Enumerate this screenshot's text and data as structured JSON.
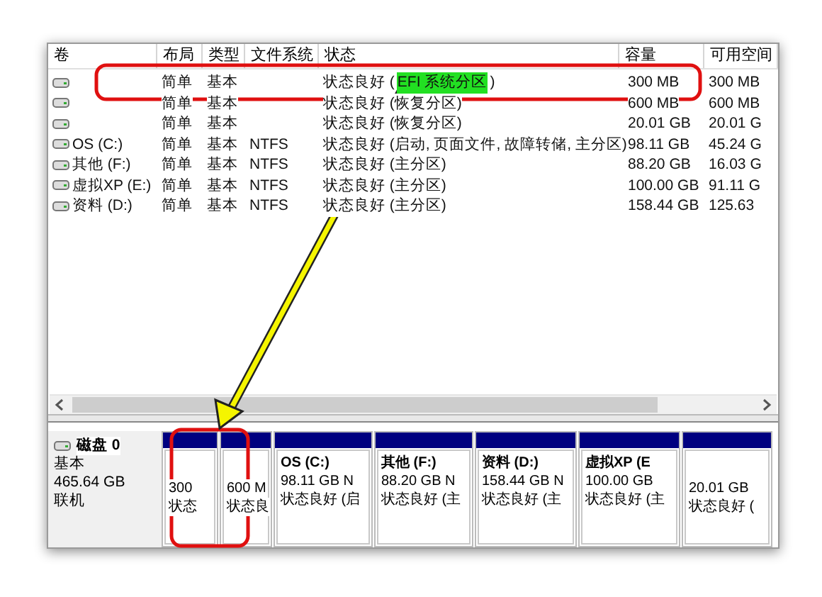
{
  "volume_table": {
    "columns": [
      "卷",
      "布局",
      "类型",
      "文件系统",
      "状态",
      "容量",
      "可用空间"
    ],
    "rows": [
      {
        "volume": "",
        "layout": "简单",
        "type": "基本",
        "file_system": "",
        "status": [
          {
            "text": "状态良好 (",
            "highlighted": false
          },
          {
            "text": "EFI 系统分区",
            "highlighted": true
          },
          {
            "text": ")",
            "highlighted": false
          }
        ],
        "capacity": "300 MB",
        "free_space": "300 MB"
      },
      {
        "volume": "",
        "layout": "简单",
        "type": "基本",
        "file_system": "",
        "status": [
          {
            "text": "状态良好 (恢复分区)",
            "highlighted": false
          }
        ],
        "capacity": "600 MB",
        "free_space": "600 MB"
      },
      {
        "volume": "",
        "layout": "简单",
        "type": "基本",
        "file_system": "",
        "status": [
          {
            "text": "状态良好 (恢复分区)",
            "highlighted": false
          }
        ],
        "capacity": "20.01 GB",
        "free_space": "20.01 G"
      },
      {
        "volume": "OS (C:)",
        "layout": "简单",
        "type": "基本",
        "file_system": "NTFS",
        "status": [
          {
            "text": "状态良好 (启动, 页面文件, 故障转储, 主分区)",
            "highlighted": false
          }
        ],
        "capacity": "98.11 GB",
        "free_space": "45.24 G"
      },
      {
        "volume": "其他 (F:)",
        "layout": "简单",
        "type": "基本",
        "file_system": "NTFS",
        "status": [
          {
            "text": "状态良好 (主分区)",
            "highlighted": false
          }
        ],
        "capacity": "88.20 GB",
        "free_space": "16.03 G"
      },
      {
        "volume": "虚拟XP (E:)",
        "layout": "简单",
        "type": "基本",
        "file_system": "NTFS",
        "status": [
          {
            "text": "状态良好 (主分区)",
            "highlighted": false
          }
        ],
        "capacity": "100.00 GB",
        "free_space": "91.11 G"
      },
      {
        "volume": "资料 (D:)",
        "layout": "简单",
        "type": "基本",
        "file_system": "NTFS",
        "status": [
          {
            "text": "状态良好 (主分区)",
            "highlighted": false
          }
        ],
        "capacity": "158.44 GB",
        "free_space": "125.63"
      }
    ]
  },
  "disk": {
    "name": "磁盘 0",
    "type": "基本",
    "size": "465.64 GB",
    "state": "联机",
    "partitions": [
      {
        "size": "300",
        "status": "状态"
      },
      {
        "size": "600 M",
        "status": "状态良"
      },
      {
        "title": "OS (C:)",
        "size": "98.11 GB N",
        "status": "状态良好 (启"
      },
      {
        "title": "其他 (F:)",
        "size": "88.20 GB N",
        "status": "状态良好 (主"
      },
      {
        "title": "资料 (D:)",
        "size": "158.44 GB N",
        "status": "状态良好 (主"
      },
      {
        "title": "虚拟XP (E",
        "size": "100.00 GB",
        "status": "状态良好 (主"
      },
      {
        "size": "20.01 GB",
        "status": "状态良好 ("
      }
    ]
  }
}
